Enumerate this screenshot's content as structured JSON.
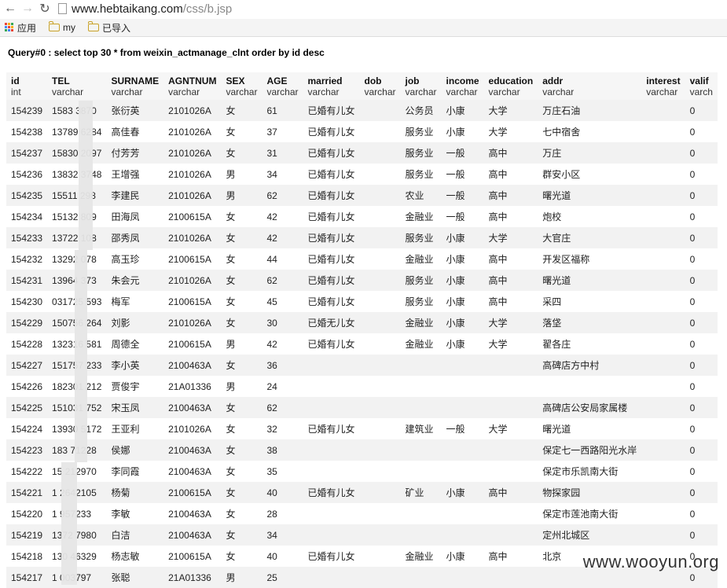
{
  "browser": {
    "back_icon": "arrow-left-icon",
    "forward_icon": "arrow-right-icon",
    "reload_icon": "reload-icon",
    "url_host": "www.hebtaikang.com",
    "url_path": "/css/b.jsp"
  },
  "bookmarks": [
    {
      "label": "应用",
      "icon": "apps-icon"
    },
    {
      "label": "my",
      "icon": "folder-icon"
    },
    {
      "label": "已导入",
      "icon": "folder-icon"
    }
  ],
  "query": "Query#0 : select top 30 * from weixin_actmanage_clnt order by id desc",
  "columns": [
    {
      "name": "id",
      "type": "int"
    },
    {
      "name": "TEL",
      "type": "varchar"
    },
    {
      "name": "SURNAME",
      "type": "varchar"
    },
    {
      "name": "AGNTNUM",
      "type": "varchar"
    },
    {
      "name": "SEX",
      "type": "varchar"
    },
    {
      "name": "AGE",
      "type": "varchar"
    },
    {
      "name": "married",
      "type": "varchar"
    },
    {
      "name": "dob",
      "type": "varchar"
    },
    {
      "name": "job",
      "type": "varchar"
    },
    {
      "name": "income",
      "type": "varchar"
    },
    {
      "name": "education",
      "type": "varchar"
    },
    {
      "name": "addr",
      "type": "varchar"
    },
    {
      "name": "interest",
      "type": "varchar"
    },
    {
      "name": "valif",
      "type": "varch"
    }
  ],
  "rows": [
    [
      "154239",
      "1583  3870",
      "张衍英",
      "2101026A",
      "女",
      "61",
      "已婚有儿女",
      "",
      "公务员",
      "小康",
      "大学",
      "万庄石油",
      "",
      "0"
    ],
    [
      "154238",
      "13789  6284",
      "高佳春",
      "2101026A",
      "女",
      "37",
      "已婚有儿女",
      "",
      "服务业",
      "小康",
      "大学",
      "七中宿舍",
      "",
      "0"
    ],
    [
      "154237",
      "15830  2097",
      "付芳芳",
      "2101026A",
      "女",
      "31",
      "已婚有儿女",
      "",
      "服务业",
      "一般",
      "高中",
      "万庄",
      "",
      "0"
    ],
    [
      "154236",
      "13832  3748",
      "王增强",
      "2101026A",
      "男",
      "34",
      "已婚有儿女",
      "",
      "服务业",
      "一般",
      "高中",
      "群安小区",
      "",
      "0"
    ],
    [
      "154235",
      "15511  298",
      "李建民",
      "2101026A",
      "男",
      "62",
      "已婚有儿女",
      "",
      "农业",
      "一般",
      "高中",
      "曙光道",
      "",
      "0"
    ],
    [
      "154234",
      "15132  809",
      "田海凤",
      "2100615A",
      "女",
      "42",
      "已婚有儿女",
      "",
      "金融业",
      "一般",
      "高中",
      "炮校",
      "",
      "0"
    ],
    [
      "154233",
      "13722  108",
      "邵秀凤",
      "2101026A",
      "女",
      "42",
      "已婚有儿女",
      "",
      "服务业",
      "小康",
      "大学",
      "大官庄",
      "",
      "0"
    ],
    [
      "154232",
      "13292  078",
      "高玉珍",
      "2100615A",
      "女",
      "44",
      "已婚有儿女",
      "",
      "金融业",
      "小康",
      "高中",
      "开发区福称",
      "",
      "0"
    ],
    [
      "154231",
      "13964  373",
      "朱会元",
      "2101026A",
      "女",
      "62",
      "已婚有儿女",
      "",
      "服务业",
      "小康",
      "高中",
      "曙光道",
      "",
      "0"
    ],
    [
      "154230",
      "031725  593",
      "梅军",
      "2100615A",
      "女",
      "45",
      "已婚有儿女",
      "",
      "服务业",
      "小康",
      "高中",
      "采四",
      "",
      "0"
    ],
    [
      "154229",
      "150756  264",
      "刘影",
      "2101026A",
      "女",
      "30",
      "已婚无儿女",
      "",
      "金融业",
      "小康",
      "大学",
      "落垡",
      "",
      "0"
    ],
    [
      "154228",
      "132316  581",
      "周德全",
      "2100615A",
      "男",
      "42",
      "已婚有儿女",
      "",
      "金融业",
      "小康",
      "大学",
      "翟各庄",
      "",
      "0"
    ],
    [
      "154227",
      "151757  233",
      "李小英",
      "2100463A",
      "女",
      "36",
      "",
      "",
      "",
      "",
      "",
      "高碑店方中村",
      "",
      "0"
    ],
    [
      "154226",
      "182301  212",
      "贾俊宇",
      "21A01336",
      "男",
      "24",
      "",
      "",
      "",
      "",
      "",
      "",
      "",
      "0"
    ],
    [
      "154225",
      "151031  752",
      "宋玉凤",
      "2100463A",
      "女",
      "62",
      "",
      "",
      "",
      "",
      "",
      "高碑店公安局家属楼",
      "",
      "0"
    ],
    [
      "154224",
      "13930  5172",
      "王亚利",
      "2101026A",
      "女",
      "32",
      "已婚有儿女",
      "",
      "建筑业",
      "一般",
      "大学",
      "曙光道",
      "",
      "0"
    ],
    [
      "154223",
      "183  71228",
      "侯娜",
      "2100463A",
      "女",
      "38",
      "",
      "",
      "",
      "",
      "",
      "保定七一西路阳光水岸",
      "",
      "0"
    ],
    [
      "154222",
      "15  212970",
      "李同霞",
      "2100463A",
      "女",
      "35",
      "",
      "",
      "",
      "",
      "",
      "保定市乐凯南大街",
      "",
      "0"
    ],
    [
      "154221",
      "1  2642105",
      "杨菊",
      "2100615A",
      "女",
      "40",
      "已婚有儿女",
      "",
      "矿业",
      "小康",
      "高中",
      "物探家园",
      "",
      "0"
    ],
    [
      "154220",
      "1  957233",
      "李敏",
      "2100463A",
      "女",
      "28",
      "",
      "",
      "",
      "",
      "",
      "保定市莲池南大街",
      "",
      "0"
    ],
    [
      "154219",
      "1372  7980",
      "白洁",
      "2100463A",
      "女",
      "34",
      "",
      "",
      "",
      "",
      "",
      "定州北城区",
      "",
      "0"
    ],
    [
      "154218",
      "130  46329",
      "杨志敏",
      "2100615A",
      "女",
      "40",
      "已婚有儿女",
      "",
      "金融业",
      "小康",
      "高中",
      "北京",
      "",
      "0"
    ],
    [
      "154217",
      "1  003797",
      "张聪",
      "21A01336",
      "男",
      "25",
      "",
      "",
      "",
      "",
      "",
      "",
      "",
      "0"
    ]
  ],
  "watermark": "www.wooyun.org"
}
